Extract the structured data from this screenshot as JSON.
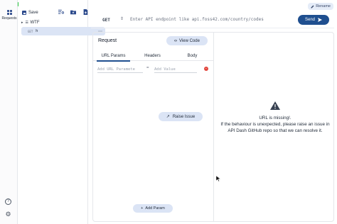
{
  "window": {
    "rename_label": "Rename"
  },
  "rail": {
    "requests_label": "Requests",
    "help_icon": "help-icon",
    "settings_icon": "gear-icon"
  },
  "collection": {
    "save_label": "Save",
    "folder_name": "WTF",
    "request_method": "GET",
    "request_name": "h"
  },
  "url_bar": {
    "method": "GET",
    "placeholder": "Enter API endpoint like api.foss42.com/country/codes",
    "send_label": "Send"
  },
  "request_pane": {
    "title": "Request",
    "view_code_label": "View Code",
    "tabs": [
      {
        "label": "URL Params",
        "active": true
      },
      {
        "label": "Headers",
        "active": false
      },
      {
        "label": "Body",
        "active": false
      }
    ],
    "param_key_placeholder": "Add URL Paramete",
    "param_value_placeholder": "Add Value",
    "equals": "=",
    "add_param_label": "Add Param"
  },
  "response_pane": {
    "message_line1": "URL is missing!.",
    "message_line2": "If the behaviour is unexpected, please raise an issue in API Dash GitHub repo so that we can resolve it.",
    "raise_issue_label": "Raise Issue"
  },
  "colors": {
    "accent": "#1f4f8f",
    "pill": "#dbe4f5",
    "danger": "#e2453c"
  }
}
